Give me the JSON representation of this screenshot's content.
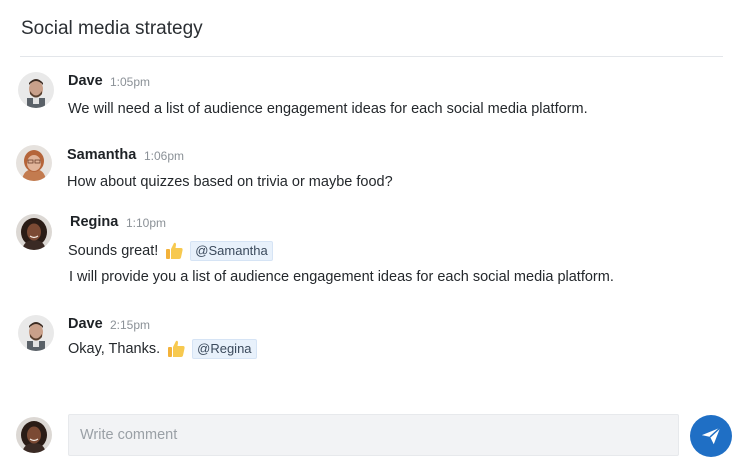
{
  "header": {
    "title": "Social media strategy"
  },
  "messages": [
    {
      "author": "Dave",
      "time": "1:05pm",
      "lines": [
        "We will need a list of audience engagement ideas for each social media platform."
      ]
    },
    {
      "author": "Samantha",
      "time": "1:06pm",
      "lines": [
        "How about quizzes based on trivia or maybe food?"
      ]
    },
    {
      "author": "Regina",
      "time": "1:10pm",
      "lines": [
        "Sounds great!",
        "I will provide you a list of audience engagement ideas for each social media platform."
      ],
      "mention": "@Samantha",
      "emoji": "thumbs-up-icon"
    },
    {
      "author": "Dave",
      "time": "2:15pm",
      "lines": [
        "Okay, Thanks."
      ],
      "mention": "@Regina",
      "emoji": "thumbs-up-icon"
    }
  ],
  "composer": {
    "placeholder": "Write comment",
    "send_icon": "paper-plane-icon"
  },
  "colors": {
    "accent": "#1f6fc5",
    "mention_bg": "#e8f1fb",
    "input_bg": "#f2f3f5"
  }
}
